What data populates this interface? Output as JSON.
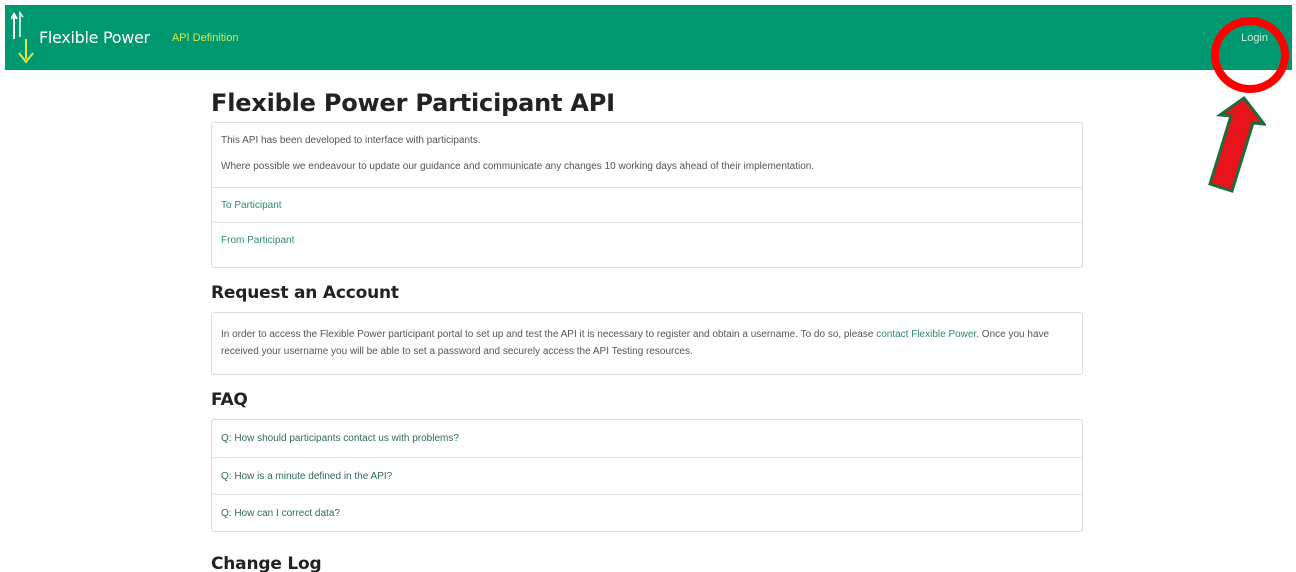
{
  "navbar": {
    "brand": "Flexible Power",
    "nav_link": "API Definition",
    "login": "Login"
  },
  "page": {
    "title": "Flexible Power Participant API",
    "intro_line1": "This API has been developed to interface with participants.",
    "intro_line2": "Where possible we endeavour to update our guidance and communicate any changes 10 working days ahead of their implementation.",
    "links": [
      "To Participant",
      "From Participant"
    ]
  },
  "request_account": {
    "title": "Request an Account",
    "text_part1": "In order to access the Flexible Power participant portal to set up and test the API it is necessary to register and obtain a username. To do so, please",
    "contact_link": "contact Flexible Power",
    "text_part2": ". Once you have received your username you will be able to set a password and securely access the API Testing resources."
  },
  "faq": {
    "title": "FAQ",
    "items": [
      "Q: How should participants contact us with problems?",
      "Q: How is a minute defined in the API?",
      "Q: How can I correct data?"
    ]
  },
  "change_log": {
    "title": "Change Log"
  },
  "colors": {
    "navbar": "#009870",
    "nav_link": "#d7e94b",
    "annotation": "#ff0000",
    "arrow_fill": "#e8141b",
    "arrow_outline": "#1d6b3a"
  },
  "icons": {
    "logo": "up-down-arrows-logo",
    "annotation": "red-circle-and-arrow"
  }
}
